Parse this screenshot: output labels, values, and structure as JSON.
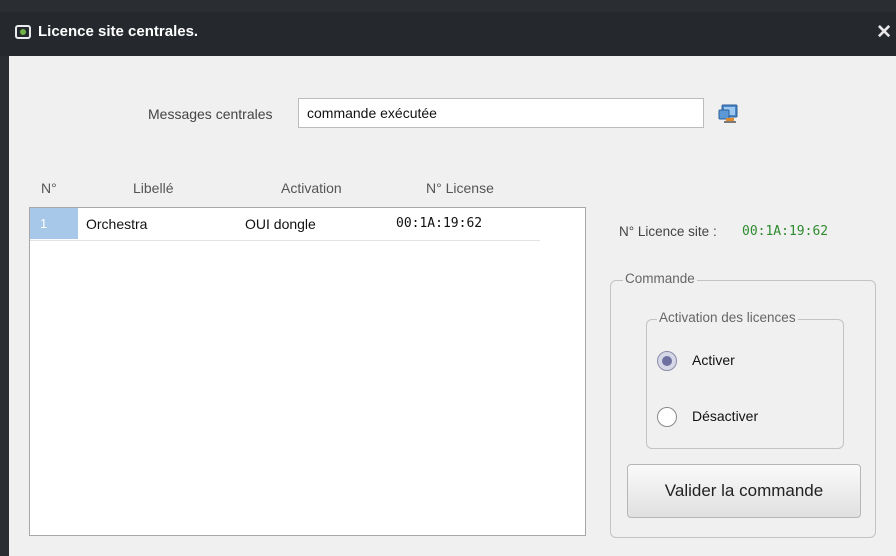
{
  "window": {
    "title": "Licence site centrales.",
    "close_glyph": "✕"
  },
  "messages": {
    "label": "Messages centrales",
    "value": "commande exécutée"
  },
  "table": {
    "columns": [
      "N°",
      "Libellé",
      "Activation",
      "N° License"
    ],
    "rows": [
      {
        "num": "1",
        "libelle": "Orchestra",
        "activation": "OUI dongle",
        "license": "00:1A:19:62"
      }
    ]
  },
  "site_licence": {
    "label": "N° Licence site :",
    "value": "00:1A:19:62",
    "value_color": "#2e8b2e"
  },
  "command_group": {
    "title": "Commande",
    "activation_group": {
      "title": "Activation des licences",
      "options": [
        {
          "label": "Activer",
          "checked": true
        },
        {
          "label": "Désactiver",
          "checked": false
        }
      ]
    },
    "validate_label": "Valider la commande"
  },
  "colors": {
    "titlebar": "#25292e",
    "selection": "#a7c8e8",
    "accent_green": "#2e8b2e"
  },
  "icons": {
    "title": "licence-window-icon",
    "messages_button": "monitor-refresh-icon",
    "close": "close-icon"
  }
}
